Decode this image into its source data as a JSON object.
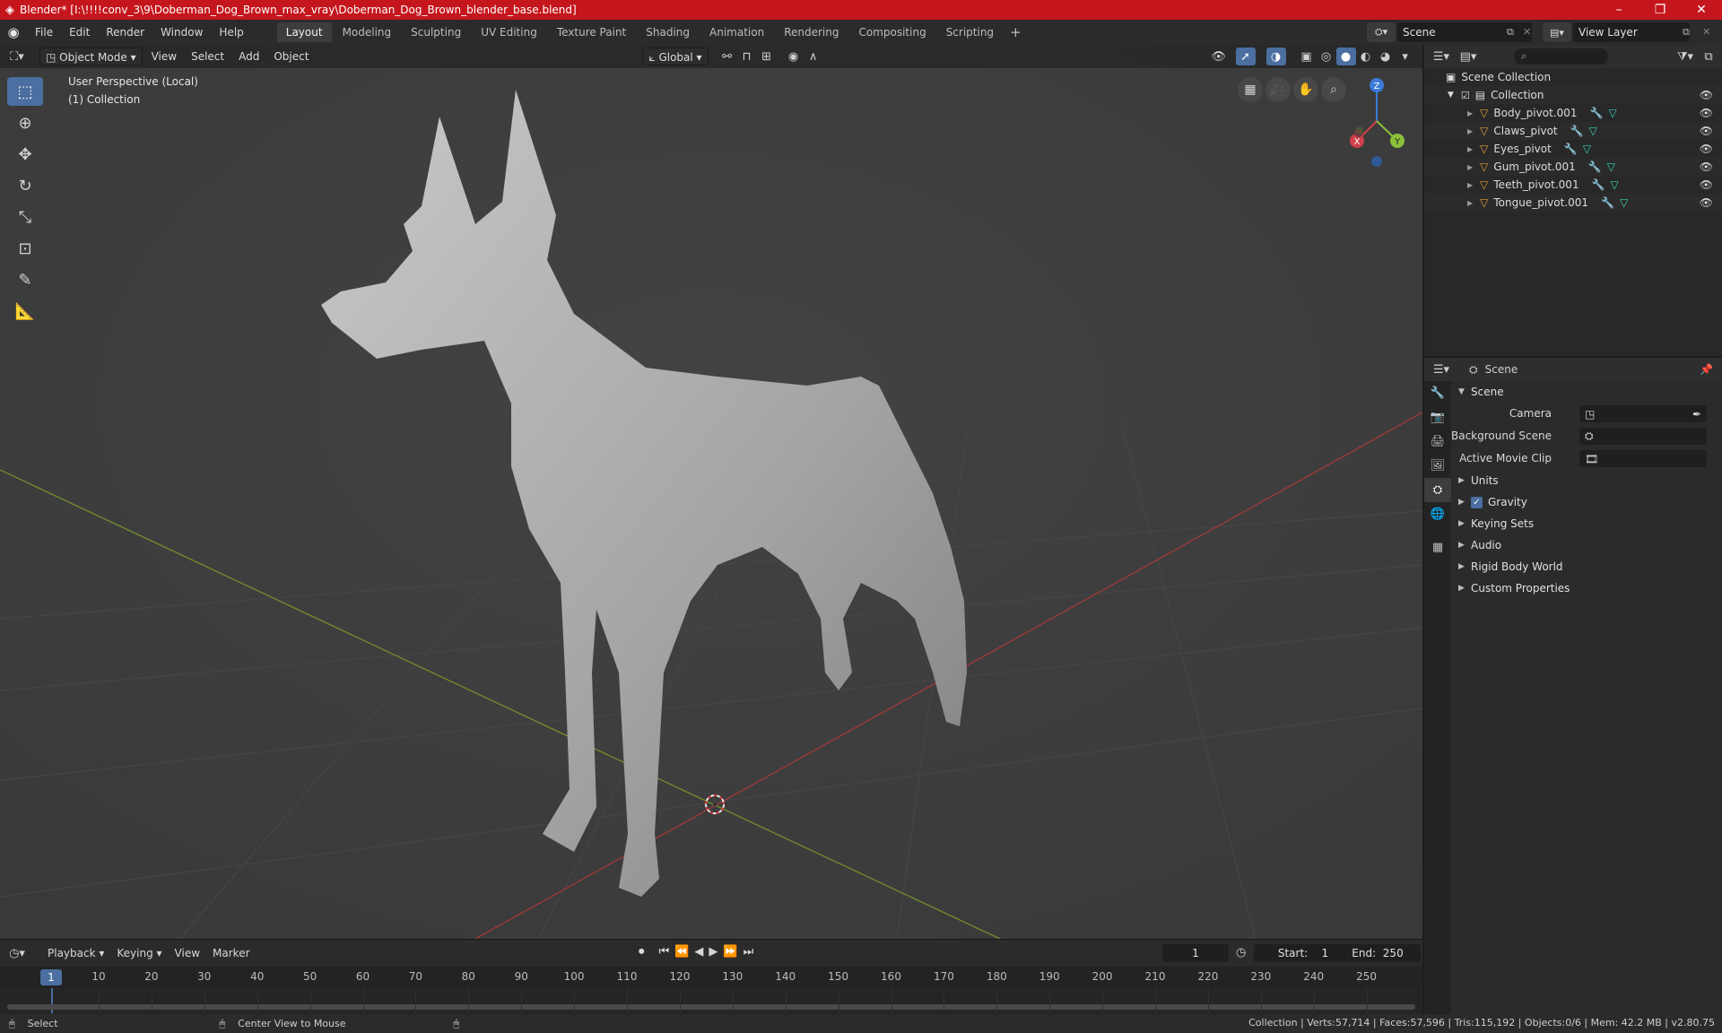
{
  "window": {
    "title": "Blender* [I:\\!!!!conv_3\\9\\Doberman_Dog_Brown_max_vray\\Doberman_Dog_Brown_blender_base.blend]",
    "minimize": "–",
    "maximize": "❐",
    "close": "✕"
  },
  "menu": {
    "file": "File",
    "edit": "Edit",
    "render": "Render",
    "window": "Window",
    "help": "Help"
  },
  "workspaces": [
    "Layout",
    "Modeling",
    "Sculpting",
    "UV Editing",
    "Texture Paint",
    "Shading",
    "Animation",
    "Rendering",
    "Compositing",
    "Scripting"
  ],
  "workspace_add": "+",
  "scene_selector": {
    "value": "Scene"
  },
  "view_layer_selector": {
    "value": "View Layer"
  },
  "viewport": {
    "mode": "Object Mode",
    "view": "View",
    "select": "Select",
    "add": "Add",
    "object": "Object",
    "orientation": "Global",
    "perspective_label": "User Perspective (Local)",
    "collection_label": "(1) Collection",
    "gizmo": {
      "x": "X",
      "y": "Y",
      "z": "Z"
    }
  },
  "timeline": {
    "playback": "Playback",
    "keying": "Keying",
    "view": "View",
    "marker": "Marker",
    "current_frame": "1",
    "start_label": "Start:",
    "start_value": "1",
    "end_label": "End:",
    "end_value": "250",
    "ruler_current": "1",
    "ruler_ticks": [
      "10",
      "20",
      "30",
      "40",
      "50",
      "60",
      "70",
      "80",
      "90",
      "100",
      "110",
      "120",
      "130",
      "140",
      "150",
      "160",
      "170",
      "180",
      "190",
      "200",
      "210",
      "220",
      "230",
      "240",
      "250"
    ]
  },
  "outliner": {
    "scene_collection": "Scene Collection",
    "collection": "Collection",
    "items": [
      "Body_pivot.001",
      "Claws_pivot",
      "Eyes_pivot",
      "Gum_pivot.001",
      "Teeth_pivot.001",
      "Tongue_pivot.001"
    ]
  },
  "properties": {
    "context": "Scene",
    "section_scene": "Scene",
    "camera_label": "Camera",
    "background_scene_label": "Background Scene",
    "active_movie_clip_label": "Active Movie Clip",
    "panels": [
      "Units",
      "Gravity",
      "Keying Sets",
      "Audio",
      "Rigid Body World",
      "Custom Properties"
    ]
  },
  "statusbar": {
    "select": "Select",
    "center_view": "Center View to Mouse",
    "stats": "Collection | Verts:57,714 | Faces:57,596 | Tris:115,192 | Objects:0/6 | Mem: 42.2 MB | v2.80.75"
  }
}
